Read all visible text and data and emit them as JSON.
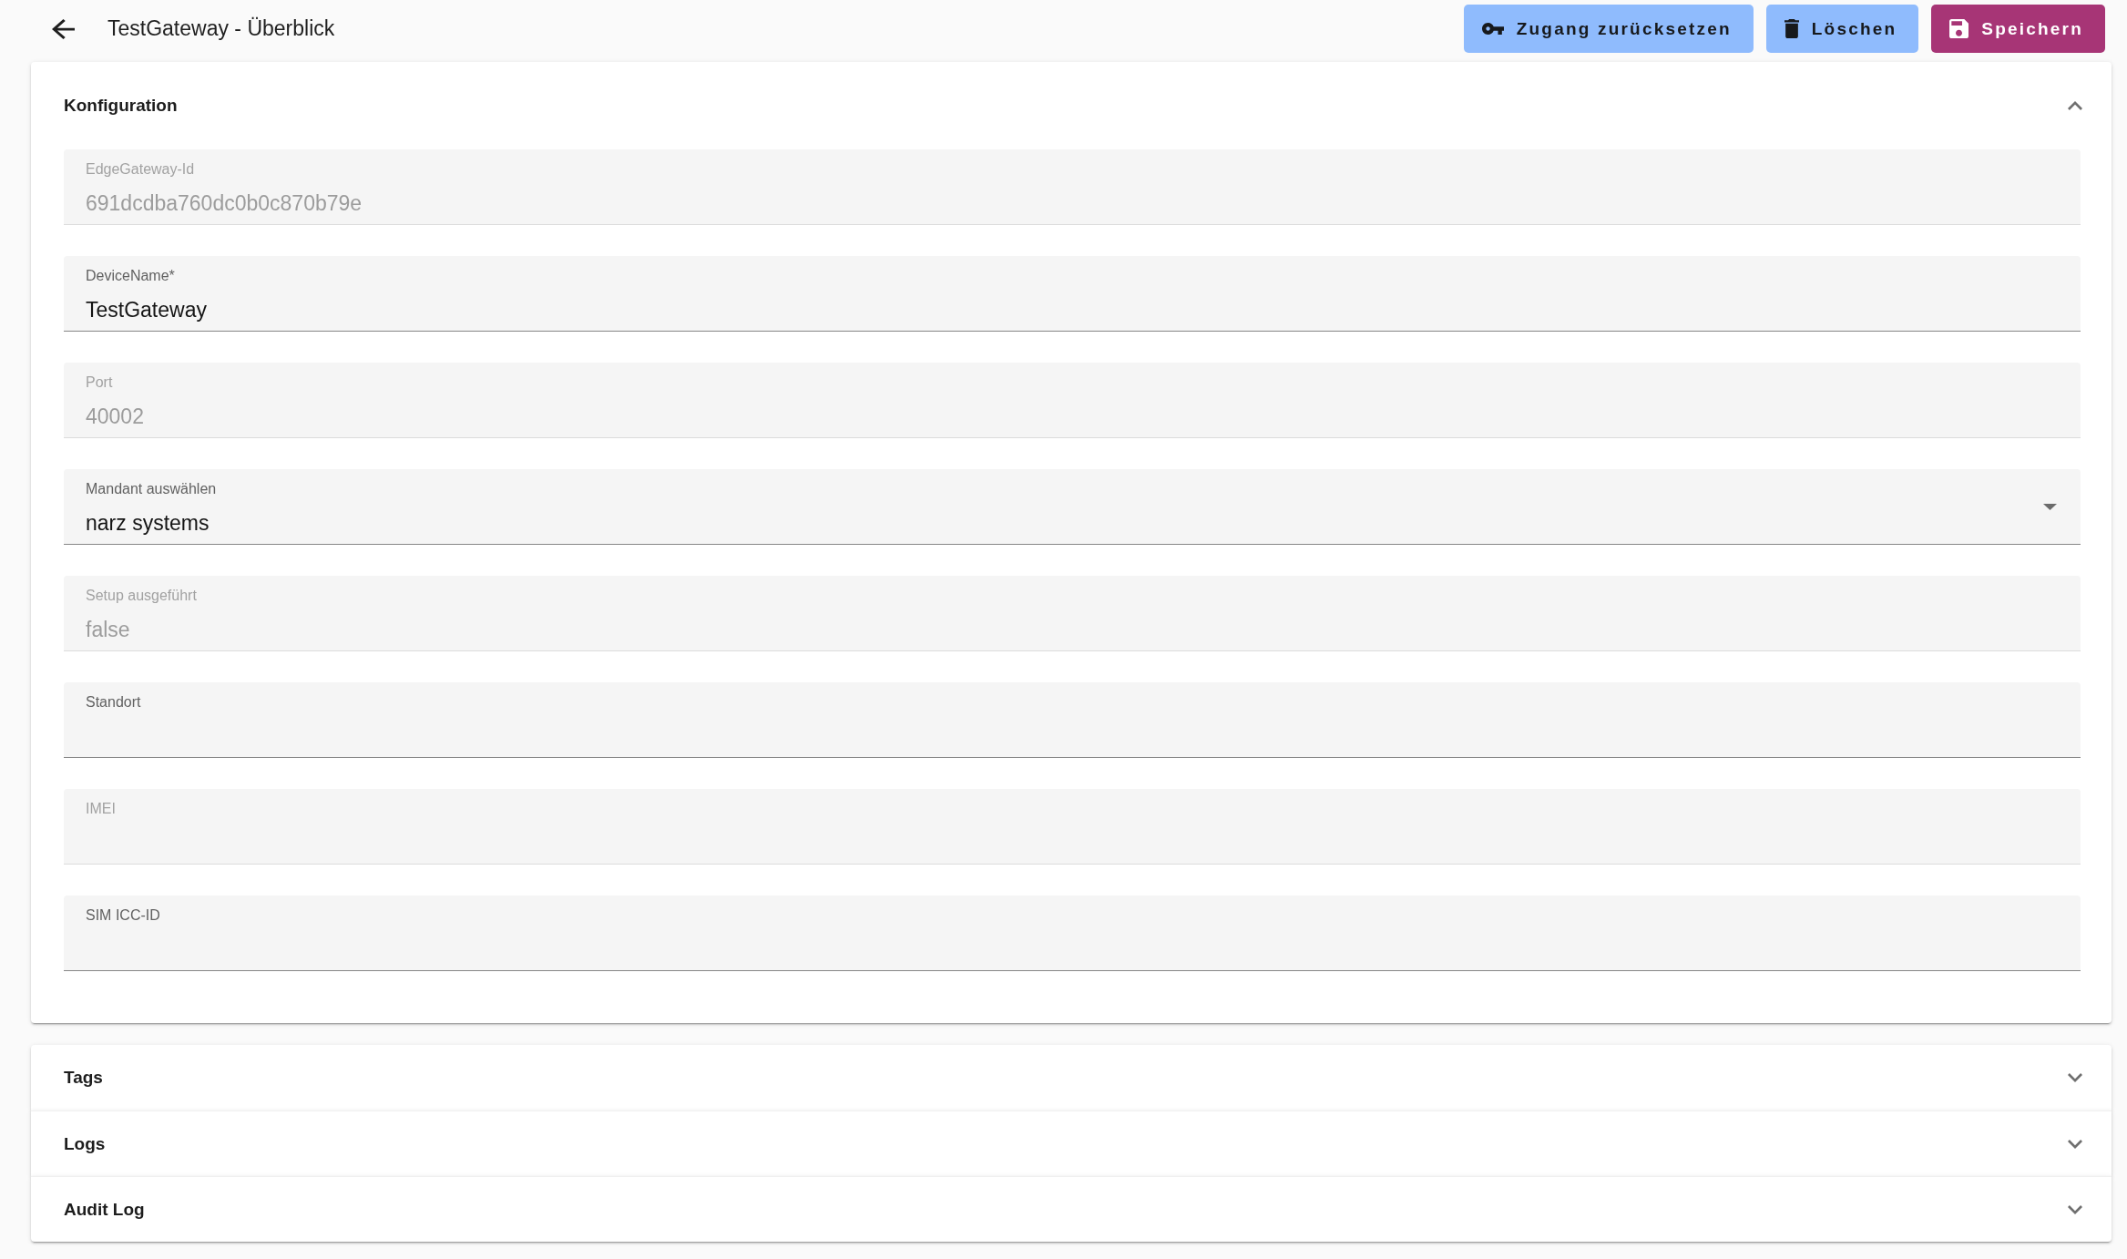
{
  "header": {
    "title": "TestGateway - Überblick"
  },
  "actions": [
    {
      "kind": "reset",
      "label": "Zugang zurücksetzen",
      "primary": false
    },
    {
      "kind": "delete",
      "label": "Löschen",
      "primary": false
    },
    {
      "kind": "save",
      "label": "Speichern",
      "primary": true
    }
  ],
  "sections": [
    {
      "title": "Konfiguration",
      "expanded": true,
      "fields": [
        {
          "kind": "text",
          "label": "EdgeGateway-Id",
          "value": "691dcdba760dc0b0c870b79e",
          "disabled": true
        },
        {
          "kind": "text",
          "label": "DeviceName*",
          "value": "TestGateway",
          "disabled": false
        },
        {
          "kind": "text",
          "label": "Port",
          "value": "40002",
          "disabled": true
        },
        {
          "kind": "select",
          "label": "Mandant auswählen",
          "value": "narz systems",
          "disabled": false
        },
        {
          "kind": "text",
          "label": "Setup ausgeführt",
          "value": "false",
          "disabled": true
        },
        {
          "kind": "text",
          "label": "Standort",
          "disabled": false
        },
        {
          "kind": "text",
          "label": "IMEI",
          "disabled": true
        },
        {
          "kind": "text",
          "label": "SIM ICC-ID",
          "disabled": false
        }
      ]
    },
    {
      "title": "Tags",
      "expanded": false
    },
    {
      "title": "Logs",
      "expanded": false
    },
    {
      "title": "Audit Log",
      "expanded": false
    }
  ]
}
